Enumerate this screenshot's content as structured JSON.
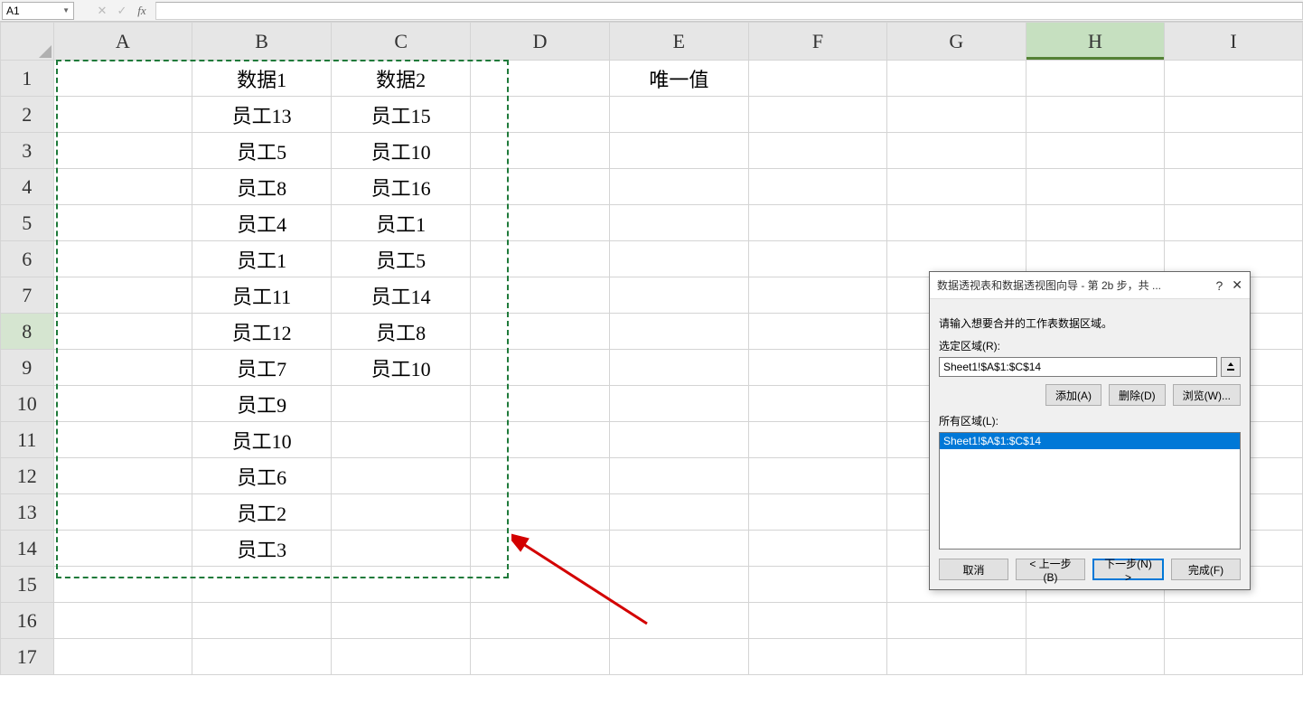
{
  "formula_bar": {
    "name_box": "A1",
    "formula": ""
  },
  "columns": [
    "A",
    "B",
    "C",
    "D",
    "E",
    "F",
    "G",
    "H",
    "I"
  ],
  "rows": [
    1,
    2,
    3,
    4,
    5,
    6,
    7,
    8,
    9,
    10,
    11,
    12,
    13,
    14,
    15,
    16,
    17
  ],
  "cells": {
    "B1": "数据1",
    "C1": "数据2",
    "E1": "唯一值",
    "B2": "员工13",
    "C2": "员工15",
    "B3": "员工5",
    "C3": "员工10",
    "B4": "员工8",
    "C4": "员工16",
    "B5": "员工4",
    "C5": "员工1",
    "B6": "员工1",
    "C6": "员工5",
    "B7": "员工11",
    "C7": "员工14",
    "B8": "员工12",
    "C8": "员工8",
    "B9": "员工7",
    "C9": "员工10",
    "B10": "员工9",
    "B11": "员工10",
    "B12": "员工6",
    "B13": "员工2",
    "B14": "员工3"
  },
  "active_col": "H",
  "active_row": 8,
  "selection": {
    "range": "A1:C14"
  },
  "dialog": {
    "title": "数据透视表和数据透视图向导 - 第 2b 步，共 ...",
    "help_label": "?",
    "prompt": "请输入想要合并的工作表数据区域。",
    "range_label": "选定区域(R):",
    "range_value": "Sheet1!$A$1:$C$14",
    "add_btn": "添加(A)",
    "delete_btn": "删除(D)",
    "browse_btn": "浏览(W)...",
    "all_ranges_label": "所有区域(L):",
    "ranges_list": [
      "Sheet1!$A$1:$C$14"
    ],
    "cancel_btn": "取消",
    "back_btn": "< 上一步(B)",
    "next_btn": "下一步(N) >",
    "finish_btn": "完成(F)"
  }
}
